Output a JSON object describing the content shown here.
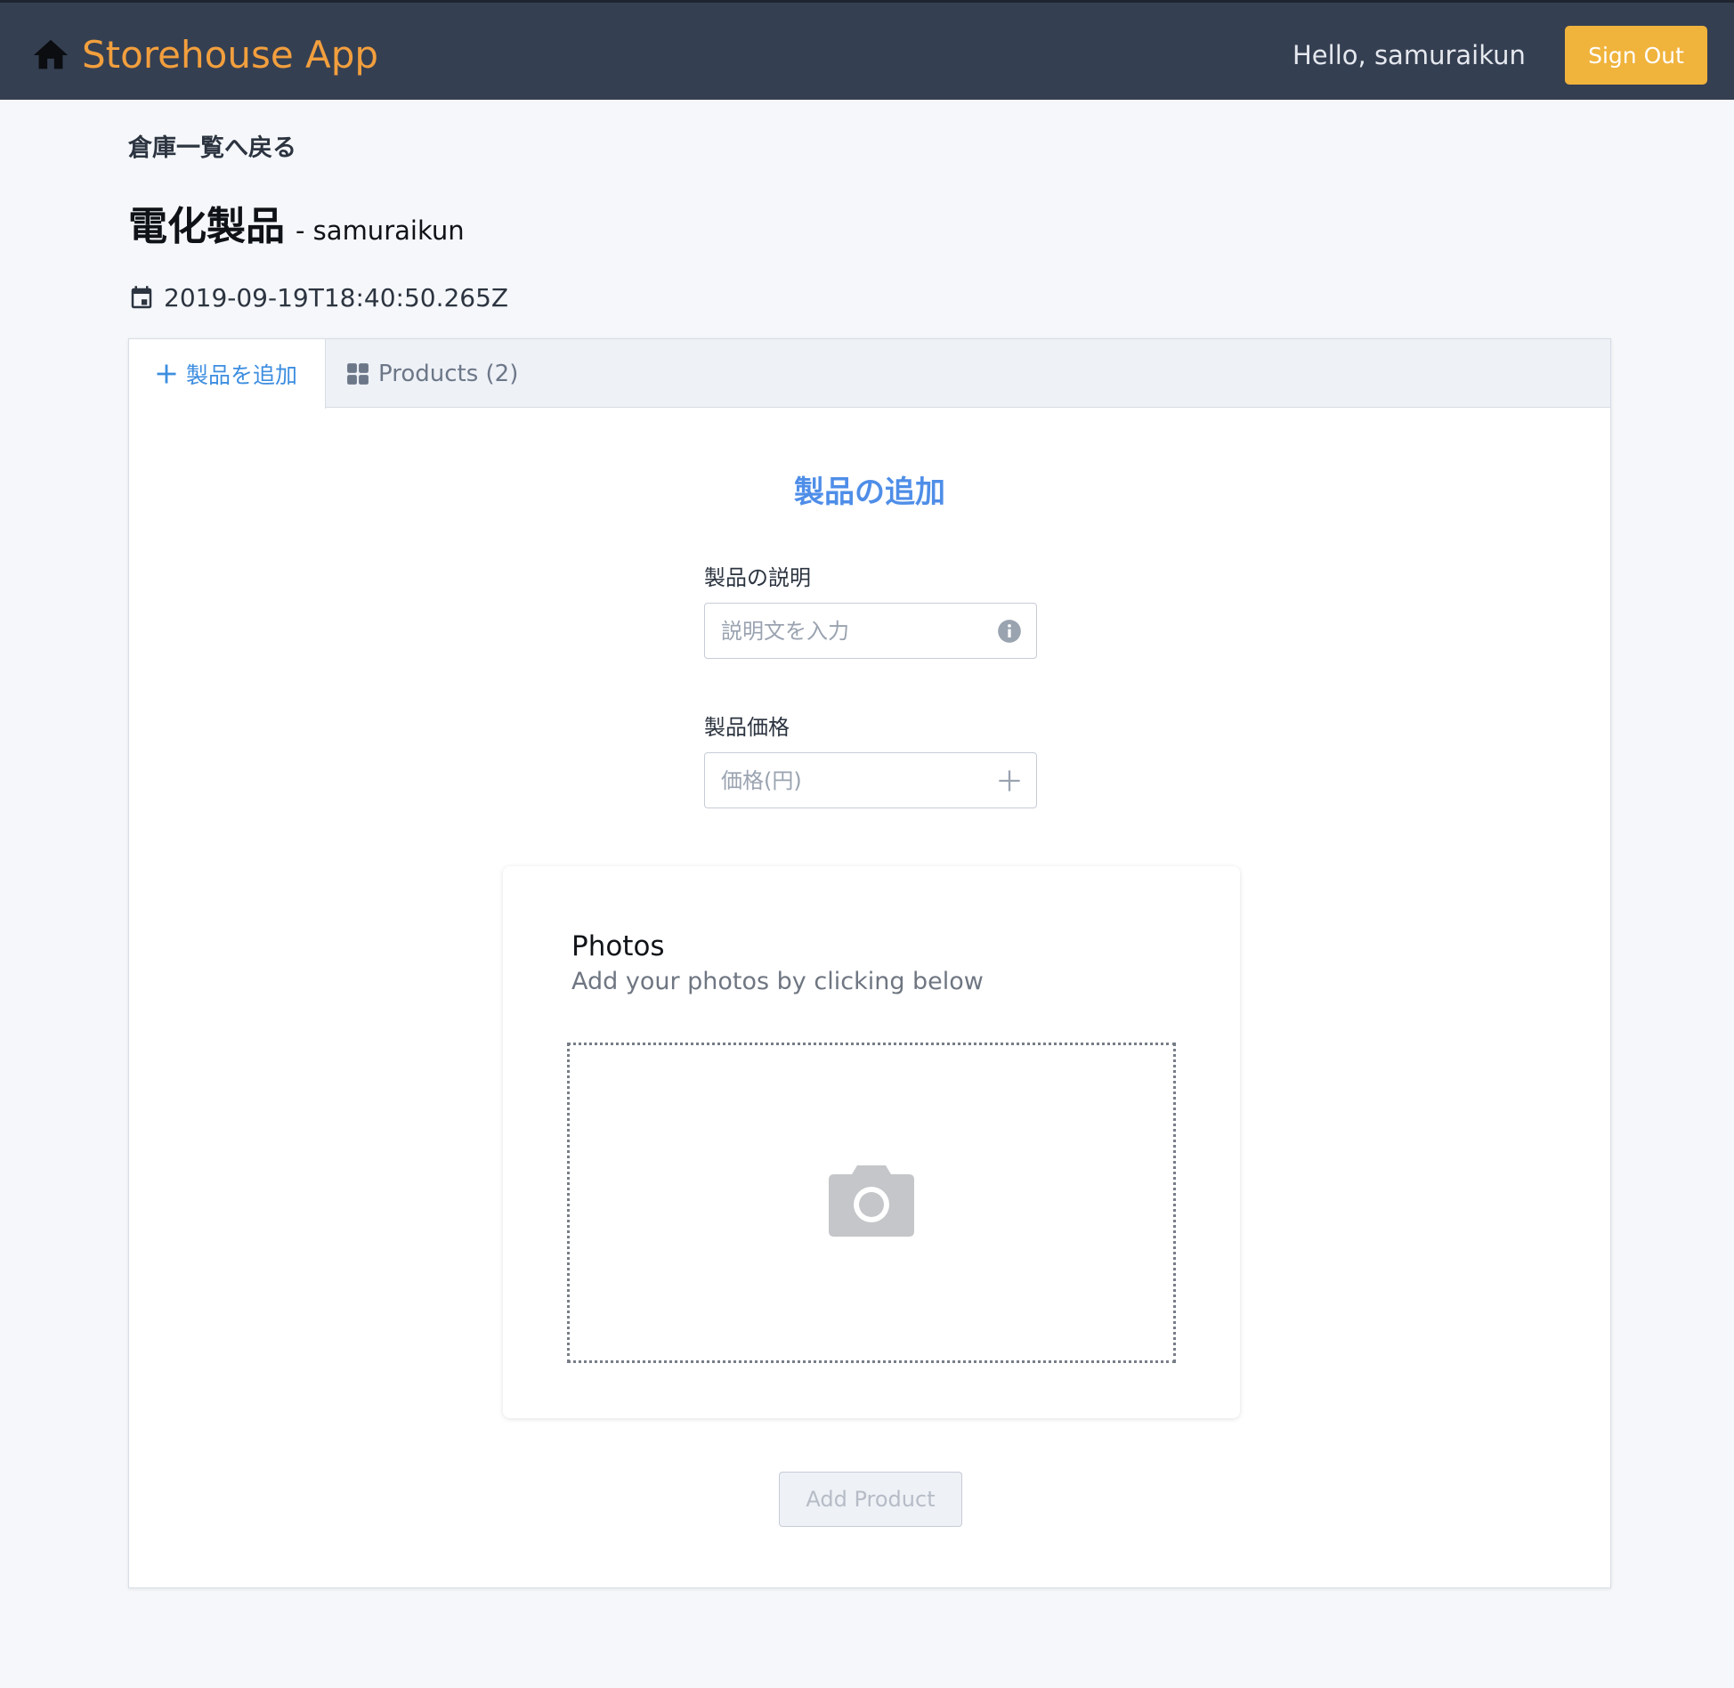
{
  "navbar": {
    "brand_icon": "home-icon",
    "app_title": "Storehouse App",
    "greeting": "Hello, samuraikun",
    "sign_out_label": "Sign Out",
    "colors": {
      "background": "#353f52",
      "brand": "#f29f3d",
      "button": "#f0b33c"
    }
  },
  "breadcrumb": {
    "back_label": "倉庫一覧へ戻る"
  },
  "storehouse": {
    "name": "電化製品",
    "owner": "- samuraikun",
    "created_icon": "calendar-icon",
    "created_at": "2019-09-19T18:40:50.265Z"
  },
  "tabs": [
    {
      "icon": "plus-icon",
      "label": "製品を追加",
      "active": true
    },
    {
      "icon": "grid-icon",
      "label": "Products (2)",
      "active": false
    }
  ],
  "form": {
    "title": "製品の追加",
    "description": {
      "label": "製品の説明",
      "placeholder": "説明文を入力",
      "value": "",
      "icon": "info-icon"
    },
    "price": {
      "label": "製品価格",
      "placeholder": "価格(円)",
      "value": "",
      "icon": "plus-icon"
    },
    "photos": {
      "title": "Photos",
      "subtitle": "Add your photos by clicking below",
      "icon": "camera-icon"
    },
    "submit_label": "Add Product",
    "accent_color": "#4f8ee8"
  }
}
